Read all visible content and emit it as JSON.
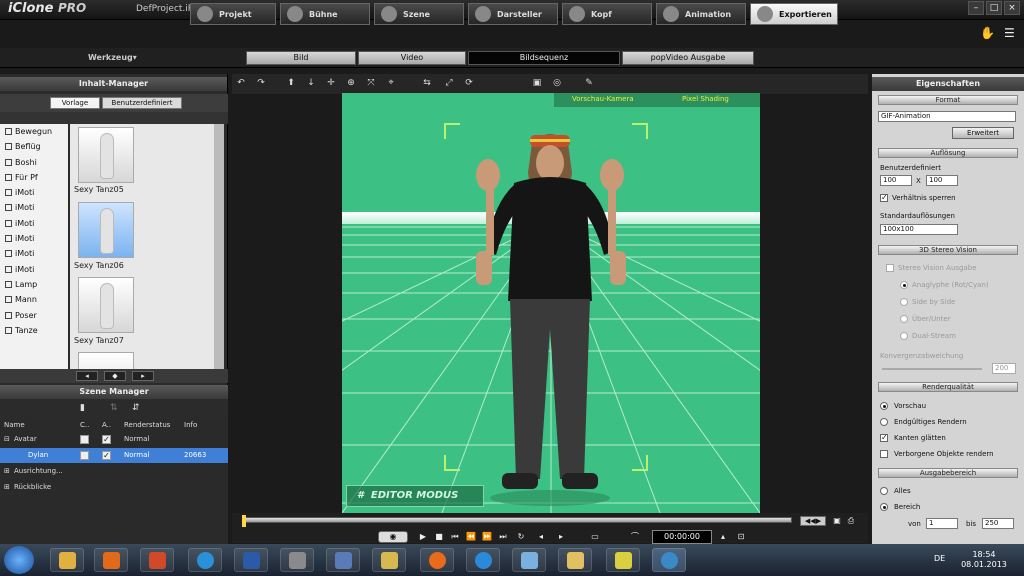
{
  "app": {
    "logo": "iClone",
    "logo_edition": "PRO",
    "project": "DefProject.iProject"
  },
  "main_tabs": [
    "Projekt",
    "Bühne",
    "Szene",
    "Darsteller",
    "Kopf",
    "Animation",
    "Exportieren"
  ],
  "toolbar": {
    "werkzeug": "Werkzeug▾"
  },
  "sub_tabs": [
    "Bild",
    "Video",
    "Bildsequenz",
    "popVideo Ausgabe"
  ],
  "content_manager": {
    "title": "Inhalt-Manager",
    "tabs": [
      "Vorlage",
      "Benutzerdefiniert"
    ],
    "tree": [
      "Bewegun",
      "Beflüg",
      "Boshi",
      "Für Pf",
      "iMoti",
      "iMoti",
      "iMoti",
      "iMoti",
      "iMoti",
      "iMoti",
      "Lamp",
      "Mann",
      "Poser",
      "Tanze"
    ],
    "thumbs": [
      "Sexy Tanz05",
      "Sexy Tanz06",
      "Sexy Tanz07"
    ]
  },
  "scene_manager": {
    "title": "Szene Manager",
    "columns": [
      "Name",
      "C..",
      "A..",
      "Renderstatus",
      "Info"
    ],
    "rows": [
      {
        "name": "Avatar",
        "render": "Normal",
        "info": ""
      },
      {
        "name": "Dylan",
        "render": "Normal",
        "info": "20663"
      },
      {
        "name": "Ausrichtung...",
        "render": "",
        "info": ""
      },
      {
        "name": "Rückblicke",
        "render": "",
        "info": ""
      }
    ]
  },
  "viewport": {
    "camera": "Vorschau-Kamera",
    "shading": "Pixel Shading",
    "mode": "EDITOR MODUS"
  },
  "timeline": {
    "timecode": "00:00:00"
  },
  "properties": {
    "title": "Eigenschaften",
    "format_head": "Format",
    "format_value": "GIF-Animation",
    "erweitert": "Erweitert",
    "aufloesung_head": "Auflösung",
    "benutzerdefiniert": "Benutzerdefiniert",
    "width": "100",
    "x": "X",
    "height": "100",
    "verhaeltnis": "Verhältnis sperren",
    "standard_label": "Standardauflösungen",
    "standard_value": "100x100",
    "stereo_head": "3D Stereo Vision",
    "stereo_items": [
      "Stereo Vision Ausgabe",
      "Anaglyphe (Rot/Cyan)",
      "Side by Side",
      "Über/Unter",
      "Dual-Stream"
    ],
    "stereo_slider_label": "Konvergenzabweichung",
    "stereo_value": "200",
    "renderqualitaet_head": "Renderqualität",
    "render_items": [
      "Vorschau",
      "Endgültiges Rendern"
    ],
    "kanten": "Kanten glätten",
    "verborgene": "Verborgene Objekte rendern",
    "ausgabe_head": "Ausgabebereich",
    "alles": "Alles",
    "bereich": "Bereich",
    "von": "von",
    "von_value": "1",
    "bis": "bis",
    "bis_value": "250"
  },
  "taskbar": {
    "lang": "DE",
    "time": "18:54",
    "date": "08.01.2013"
  },
  "colors": {
    "viewport": "#3dc083",
    "selection": "#3f7fd6",
    "accent_yellow": "#f0f030"
  }
}
